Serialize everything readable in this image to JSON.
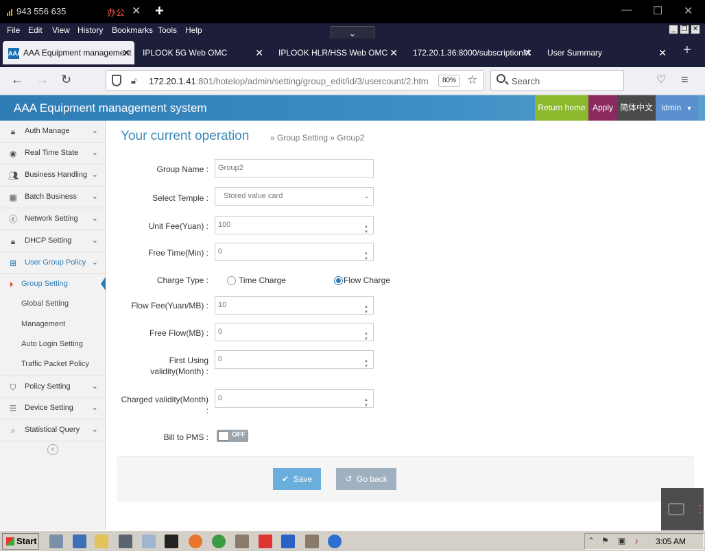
{
  "titlebar": {
    "phone": "943 556 635",
    "office": "办公",
    "close": "✕",
    "new_tab": "+",
    "minimize": "—",
    "maximize": "☐",
    "window_close": "✕"
  },
  "menubar": {
    "items": [
      "File",
      "Edit",
      "View",
      "History",
      "Bookmarks",
      "Tools",
      "Help"
    ],
    "drop": "⌄"
  },
  "tabs": [
    {
      "label": "AAA Equipment management",
      "active": true
    },
    {
      "label": "IPLOOK 5G Web OMC"
    },
    {
      "label": "IPLOOK HLR/HSS Web OMC"
    },
    {
      "label": "172.20.1.36:8000/subscriptionM"
    },
    {
      "label": "User Summary"
    }
  ],
  "tab_close": "✕",
  "nav": {
    "back": "←",
    "forward": "→",
    "reload": "↻",
    "url_host": "172.20.1.41",
    "url_rest": ":801/hotelop/admin/setting/group_edit/id/3/usercount/2.htm",
    "zoom": "80%",
    "bookmark": "☆",
    "search_placeholder": "Search",
    "pocket": "♡",
    "menu": "≡"
  },
  "app": {
    "title": "AAA Equipment management system",
    "return_home": "Return home",
    "apply": "Apply",
    "lang": "简体中文",
    "user": "idmin"
  },
  "sidebar": {
    "items": [
      {
        "label": "Auth Manage",
        "icon": "lock-icon"
      },
      {
        "label": "Real Time State",
        "icon": "radar-icon"
      },
      {
        "label": "Business Handling",
        "icon": "users-icon"
      },
      {
        "label": "Batch Business",
        "icon": "grid-icon"
      },
      {
        "label": "Network Setting",
        "icon": "ie-icon"
      },
      {
        "label": "DHCP Setting",
        "icon": "lock-icon"
      },
      {
        "label": "User Group Policy",
        "icon": "sitemap-icon"
      }
    ],
    "subitems": [
      "Group Setting",
      "Global Setting",
      "Management",
      "Auto Login Setting",
      "Traffic Packet Policy"
    ],
    "items_after": [
      {
        "label": "Policy Setting",
        "icon": "shield-icon"
      },
      {
        "label": "Device Setting",
        "icon": "server-icon"
      },
      {
        "label": "Statistical Query",
        "icon": "search-icon"
      }
    ],
    "collapse": "«",
    "chevron": "⌄"
  },
  "main": {
    "op_title": "Your current operation",
    "crumb": "» Group Setting » Group2",
    "fields": {
      "group_name_label": "Group Name :",
      "group_name_value": "Group2",
      "temple_label": "Select Temple :",
      "temple_value": "Stored value card",
      "unit_fee_label": "Unit Fee(Yuan) :",
      "unit_fee_value": "100",
      "free_time_label": "Free Time(Min) :",
      "free_time_value": "0",
      "charge_type_label": "Charge Type :",
      "time_charge": "Time Charge",
      "flow_charge": "Flow Charge",
      "flow_fee_label": "Flow Fee(Yuan/MB) :",
      "flow_fee_value": "10",
      "free_flow_label": "Free Flow(MB) :",
      "free_flow_value": "0",
      "first_using_label_1": "First Using",
      "first_using_label_2": "validity(Month) :",
      "first_using_value": "0",
      "charged_label_1": "Charged validity(Month)",
      "charged_label_2": ":",
      "charged_value": "0",
      "bill_label": "Bill to PMS :",
      "bill_toggle": "OFF"
    },
    "save": "Save",
    "go_back": "Go back"
  },
  "taskbar": {
    "start": "Start",
    "clock": "3:05 AM"
  },
  "colors": {
    "header_blue": "#2f7cb5",
    "return_home": "#8ab92d",
    "apply": "#8b2a5e",
    "lang": "#4a4a4a",
    "user": "#5a8fd0",
    "save": "#6aaedb",
    "go_back": "#9fb0c0"
  }
}
